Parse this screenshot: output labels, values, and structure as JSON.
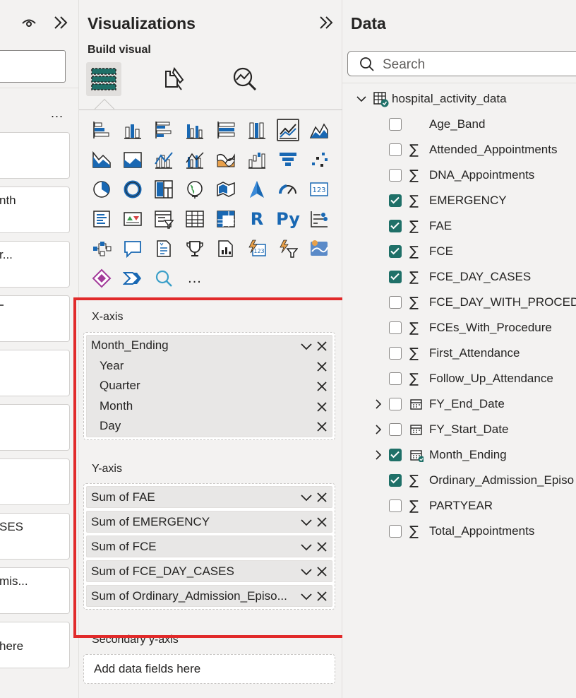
{
  "filters": {
    "card_labels": [
      "",
      "nth",
      "r...",
      "",
      "",
      "",
      "",
      "SES",
      "mis...",
      "here"
    ],
    "more": "..."
  },
  "visualizations": {
    "title": "Visualizations",
    "build_visual": "Build visual",
    "tabs": [
      "build-visual-icon",
      "format-visual-icon",
      "analytics-icon"
    ],
    "more_visuals": "...",
    "icons": [
      "stacked-bar-chart-icon",
      "stacked-column-chart-icon",
      "clustered-bar-chart-icon",
      "clustered-column-chart-icon",
      "100-stacked-bar-chart-icon",
      "100-stacked-column-chart-icon",
      "line-chart-icon",
      "area-chart-icon",
      "stacked-area-chart-icon",
      "100-stacked-area-chart-icon",
      "line-and-stacked-column-icon",
      "line-and-clustered-column-icon",
      "ribbon-chart-icon",
      "waterfall-chart-icon",
      "funnel-chart-icon",
      "scatter-chart-icon",
      "pie-chart-icon",
      "donut-chart-icon",
      "treemap-icon",
      "map-icon",
      "filled-map-icon",
      "azure-map-icon",
      "gauge-icon",
      "card-icon",
      "multi-row-card-icon",
      "kpi-icon",
      "slicer-icon",
      "table-icon",
      "matrix-icon",
      "r-script-visual-icon",
      "python-visual-icon",
      "key-influencers-icon",
      "decomposition-tree-icon",
      "qa-icon",
      "smart-narrative-icon",
      "metrics-icon",
      "paginated-report-icon",
      "power-apps-icon",
      "power-automate-icon",
      "arcgis-map-icon",
      "power-apps-visual-icon",
      "power-automate-visual-icon",
      "find-visuals-icon"
    ],
    "x_axis": {
      "label": "X-axis",
      "field": "Month_Ending",
      "hierarchy": [
        "Year",
        "Quarter",
        "Month",
        "Day"
      ]
    },
    "y_axis": {
      "label": "Y-axis",
      "fields": [
        "Sum of FAE",
        "Sum of EMERGENCY",
        "Sum of FCE",
        "Sum of FCE_DAY_CASES",
        "Sum of Ordinary_Admission_Episo..."
      ]
    },
    "secondary_y_axis": {
      "label": "Secondary y-axis",
      "placeholder": "Add data fields here"
    }
  },
  "data": {
    "title": "Data",
    "search_placeholder": "Search",
    "table": "hospital_activity_data",
    "fields": [
      {
        "name": "Age_Band",
        "checked": false,
        "icon": "",
        "expandable": false
      },
      {
        "name": "Attended_Appointments",
        "checked": false,
        "icon": "sigma",
        "expandable": false
      },
      {
        "name": "DNA_Appointments",
        "checked": false,
        "icon": "sigma",
        "expandable": false
      },
      {
        "name": "EMERGENCY",
        "checked": true,
        "icon": "sigma",
        "expandable": false
      },
      {
        "name": "FAE",
        "checked": true,
        "icon": "sigma",
        "expandable": false
      },
      {
        "name": "FCE",
        "checked": true,
        "icon": "sigma",
        "expandable": false
      },
      {
        "name": "FCE_DAY_CASES",
        "checked": true,
        "icon": "sigma",
        "expandable": false
      },
      {
        "name": "FCE_DAY_WITH_PROCEDU",
        "checked": false,
        "icon": "sigma",
        "expandable": false
      },
      {
        "name": "FCEs_With_Procedure",
        "checked": false,
        "icon": "sigma",
        "expandable": false
      },
      {
        "name": "First_Attendance",
        "checked": false,
        "icon": "sigma",
        "expandable": false
      },
      {
        "name": "Follow_Up_Attendance",
        "checked": false,
        "icon": "sigma",
        "expandable": false
      },
      {
        "name": "FY_End_Date",
        "checked": false,
        "icon": "calendar",
        "expandable": true
      },
      {
        "name": "FY_Start_Date",
        "checked": false,
        "icon": "calendar",
        "expandable": true
      },
      {
        "name": "Month_Ending",
        "checked": true,
        "icon": "calendar",
        "expandable": true
      },
      {
        "name": "Ordinary_Admission_Episo",
        "checked": true,
        "icon": "sigma",
        "expandable": false
      },
      {
        "name": "PARTYEAR",
        "checked": false,
        "icon": "sigma",
        "expandable": false
      },
      {
        "name": "Total_Appointments",
        "checked": false,
        "icon": "sigma",
        "expandable": false
      }
    ]
  },
  "colors": {
    "accent_teal": "#1f7068",
    "highlight_red": "#e12a2a",
    "icon_blue": "#1968b3",
    "pane_bg": "#f3f2f1"
  }
}
